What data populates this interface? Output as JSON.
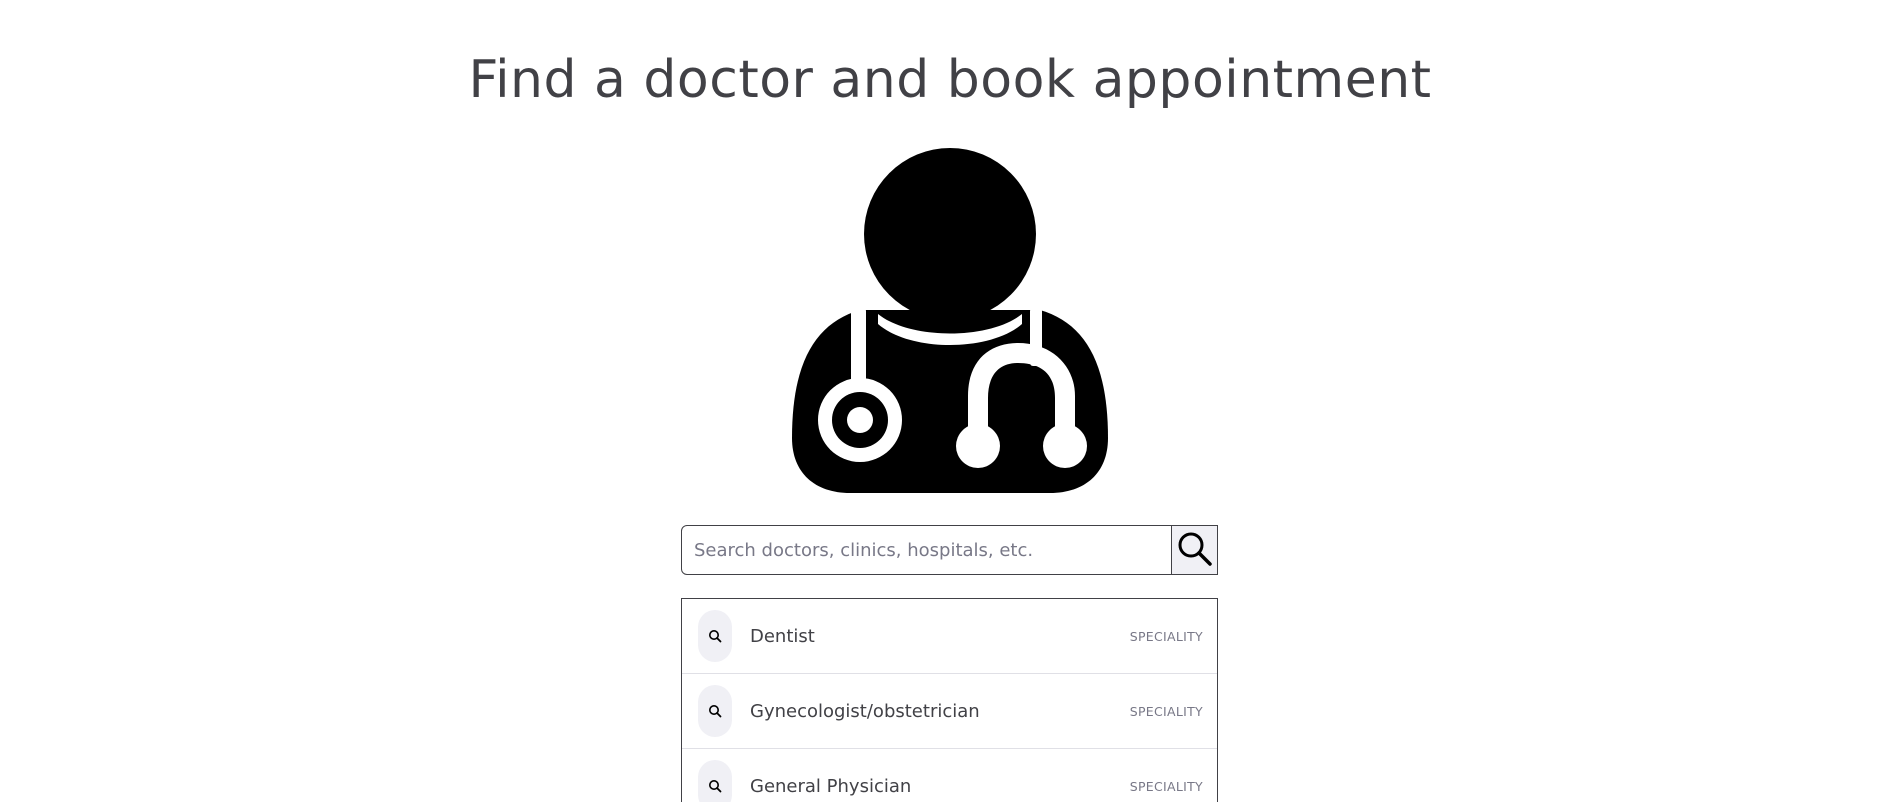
{
  "header": {
    "title": "Find a doctor and book appointment"
  },
  "hero": {
    "icon": "doctor-stethoscope-icon",
    "color": "#000000"
  },
  "search": {
    "placeholder": "Search doctors, clinics, hospitals, etc.",
    "value": "",
    "button_icon": "search-icon"
  },
  "suggestions": {
    "items": [
      {
        "label": "Dentist",
        "type": "SPECIALITY",
        "icon": "search-icon"
      },
      {
        "label": "Gynecologist/obstetrician",
        "type": "SPECIALITY",
        "icon": "search-icon"
      },
      {
        "label": "General Physician",
        "type": "SPECIALITY",
        "icon": "search-icon"
      }
    ]
  },
  "colors": {
    "text": "#414146",
    "muted": "#787887",
    "icon_bg": "#f0f0f5",
    "border": "#414146"
  }
}
